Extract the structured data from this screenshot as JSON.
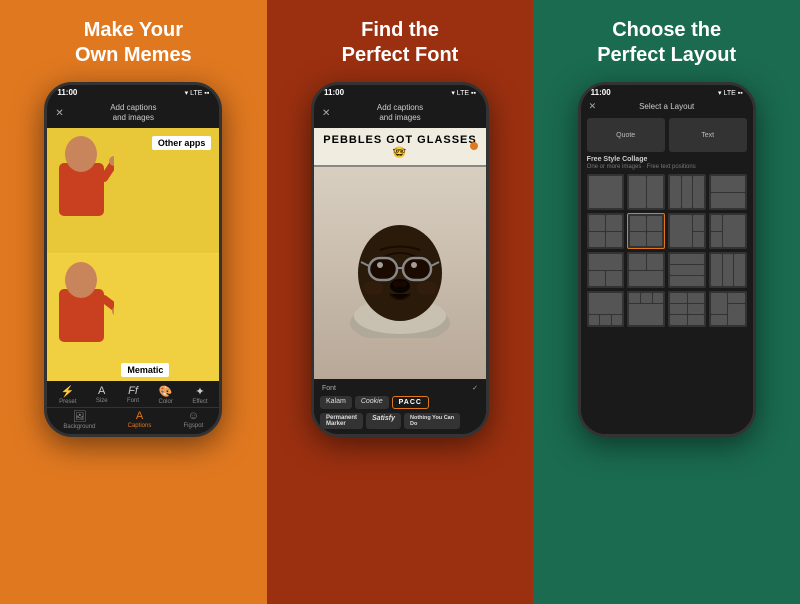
{
  "panel1": {
    "title": "Make Your\nOwn Memes",
    "phone": {
      "status_time": "11:00",
      "status_icons": "▾ LTE ▪",
      "top_bar_close": "✕",
      "top_bar_title": "Add captions\nand images",
      "meme_label_top": "Other apps",
      "meme_label_bottom": "Mematic",
      "toolbar_items": [
        {
          "icon": "⚡",
          "label": "Preset"
        },
        {
          "icon": "A",
          "label": "Size"
        },
        {
          "icon": "Ff",
          "label": "Font"
        },
        {
          "icon": "●",
          "label": "Color"
        },
        {
          "icon": "✦",
          "label": "Effect"
        }
      ],
      "tab_items": [
        {
          "icon": "🖼",
          "label": "Background"
        },
        {
          "icon": "A",
          "label": "Captions",
          "active": true
        },
        {
          "icon": "☺",
          "label": "Figspot"
        }
      ]
    }
  },
  "panel2": {
    "title": "Find the\nPerfect Font",
    "phone": {
      "status_time": "11:00",
      "status_icons": "▾ LTE ▪",
      "top_bar_close": "✕",
      "top_bar_title": "Add captions\nand images",
      "meme_text": "PEBBLES GOT GLASSES 🤓",
      "font_label": "Font",
      "font_checkmark": "✓",
      "font_options": [
        "Kalam",
        "Cookie",
        "PACC"
      ],
      "font_options_2": [
        "Permanent\nMarker",
        "Satisfy",
        "Nothing You Can Do"
      ]
    }
  },
  "panel3": {
    "title": "Choose the\nPerfect Layout",
    "phone": {
      "status_time": "11:00",
      "status_icons": "▾ LTE ▪",
      "top_bar_close": "✕",
      "layout_title": "Select a Layout",
      "preset_labels": [
        "Quote",
        "Text"
      ],
      "section_title": "Free Style Collage",
      "section_sub": "One or more images · Free text positions"
    }
  }
}
